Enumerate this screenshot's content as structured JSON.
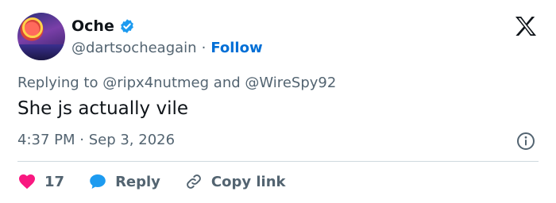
{
  "author": {
    "name": "Oche",
    "handle": "@dartsocheagain",
    "follow_label": "Follow",
    "separator": "·"
  },
  "tweet": {
    "replying_prefix": "Replying to",
    "mention_1": "@ripx4nutmeg",
    "mention_and": "and",
    "mention_2": "@WireSpy92",
    "text": "She js actually vile",
    "timestamp": "4:37 PM · Sep 3, 2026"
  },
  "actions": {
    "like_count": "17",
    "reply_label": "Reply",
    "copy_link_label": "Copy link"
  },
  "icons": {
    "verified": "verified-badge-icon",
    "logo": "x-logo-icon",
    "info": "info-icon",
    "like": "heart-icon",
    "reply": "speech-bubble-icon",
    "link": "link-icon"
  },
  "colors": {
    "accent_blue": "#1d9bf0",
    "follow_blue": "#006fd6",
    "like_pink": "#f91880",
    "text_primary": "#0f1419",
    "text_secondary": "#536471"
  }
}
